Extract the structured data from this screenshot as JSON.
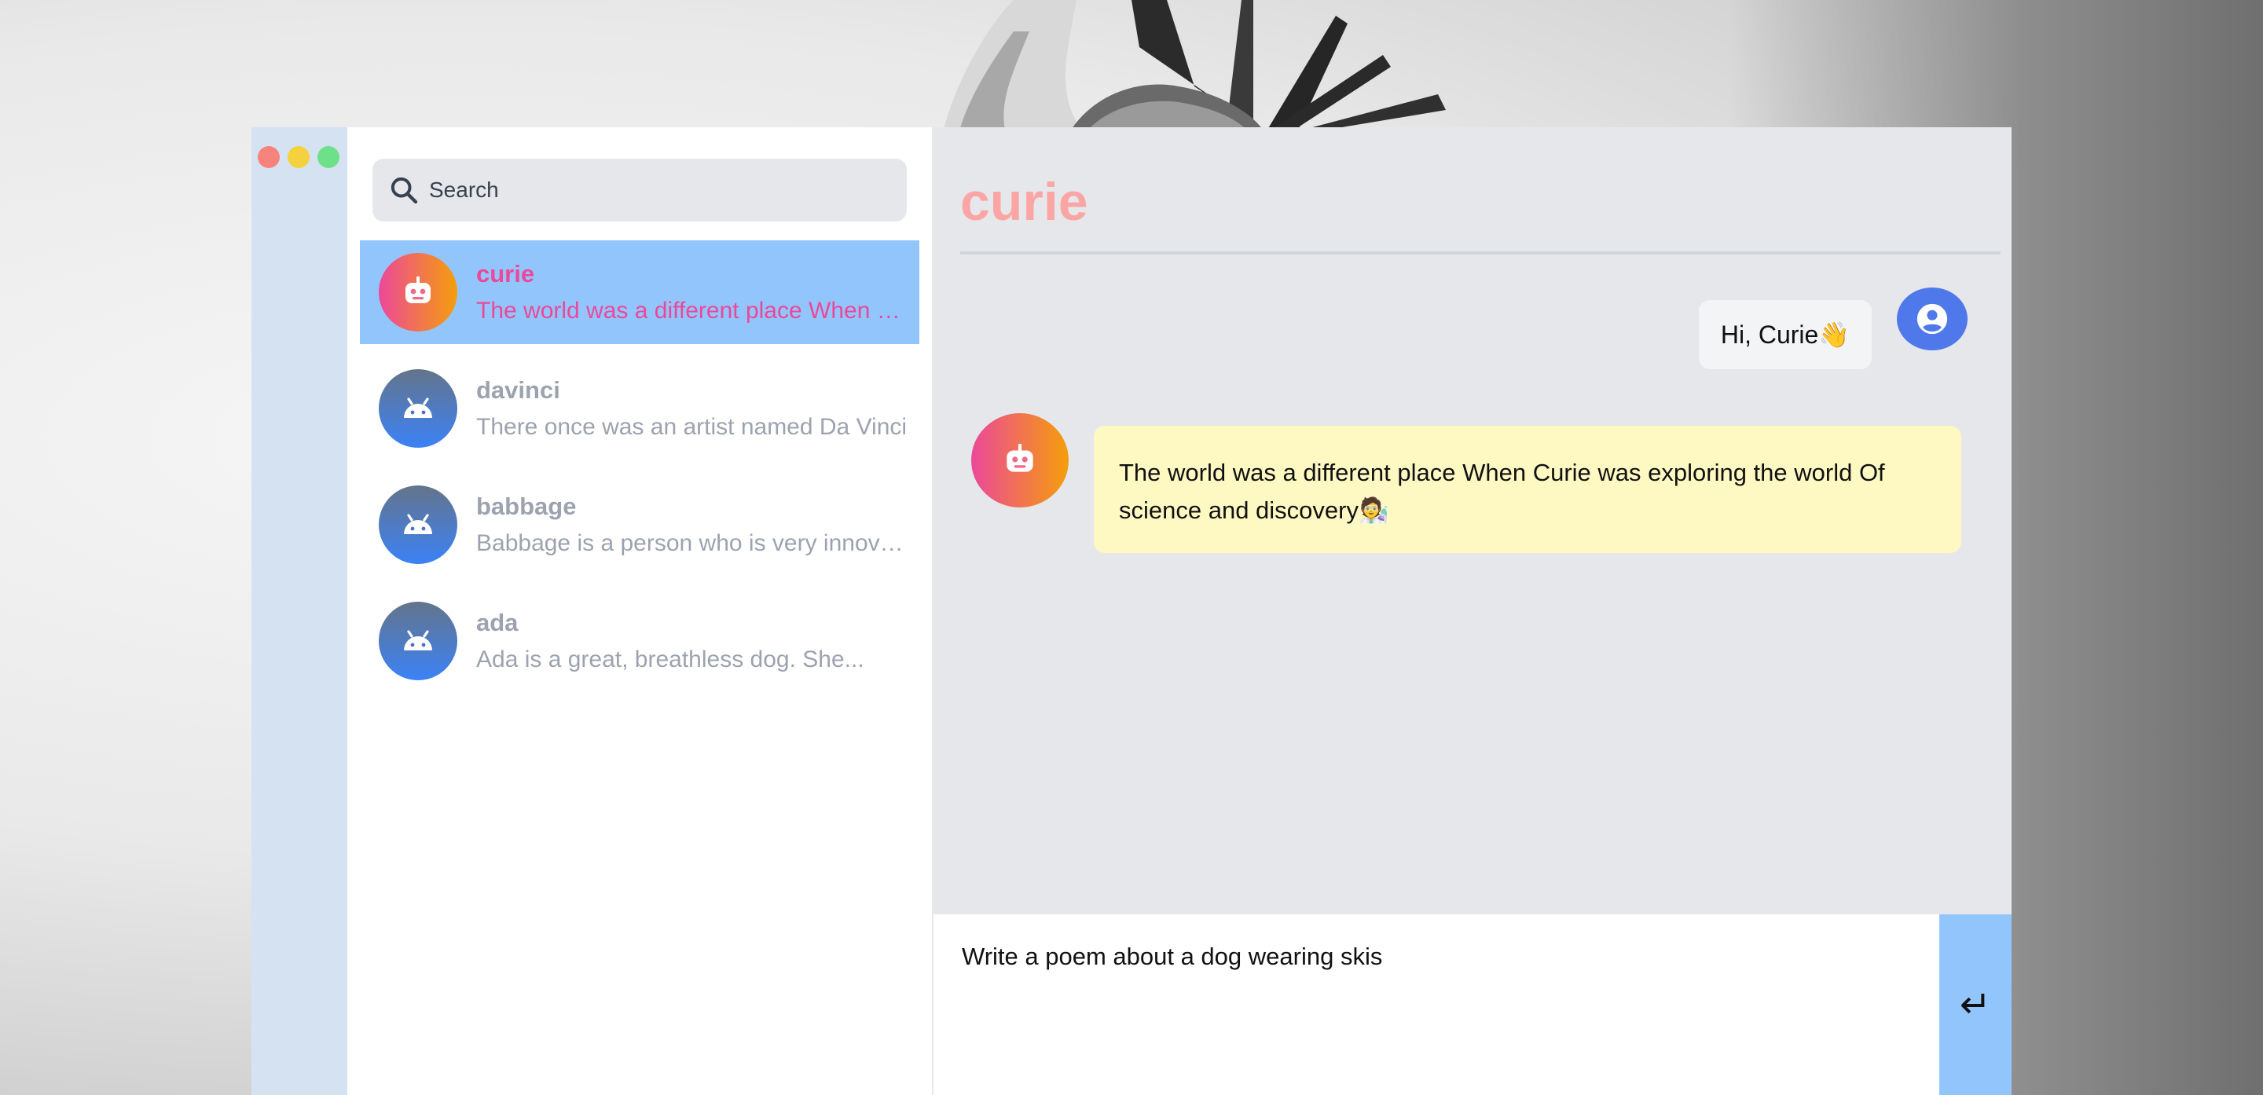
{
  "app": {
    "accent_color": "#ec4899",
    "selected_color": "#93c5fd"
  },
  "search": {
    "placeholder": "Search"
  },
  "chats": [
    {
      "name": "curie",
      "preview": "The world was a different place When Curie was exploring the world Of science and discovery",
      "avatar": "robot-icon",
      "active": true
    },
    {
      "name": "davinci",
      "preview": "There once was an artist named Da Vinci",
      "avatar": "android-icon",
      "active": false
    },
    {
      "name": "babbage",
      "preview": "Babbage is a person who is very innovative",
      "avatar": "android-icon",
      "active": false
    },
    {
      "name": "ada",
      "preview": "Ada is a great, breathless dog. She...",
      "avatar": "android-icon",
      "active": false
    }
  ],
  "conversation": {
    "title": "curie",
    "messages": [
      {
        "from": "user",
        "text": "Hi, Curie👋"
      },
      {
        "from": "bot",
        "text": "The world was a different place When Curie was exploring the world Of science and discovery🧑‍🔬"
      }
    ]
  },
  "composer": {
    "value": "Write a poem about a dog wearing skis",
    "send_label": "↵"
  }
}
